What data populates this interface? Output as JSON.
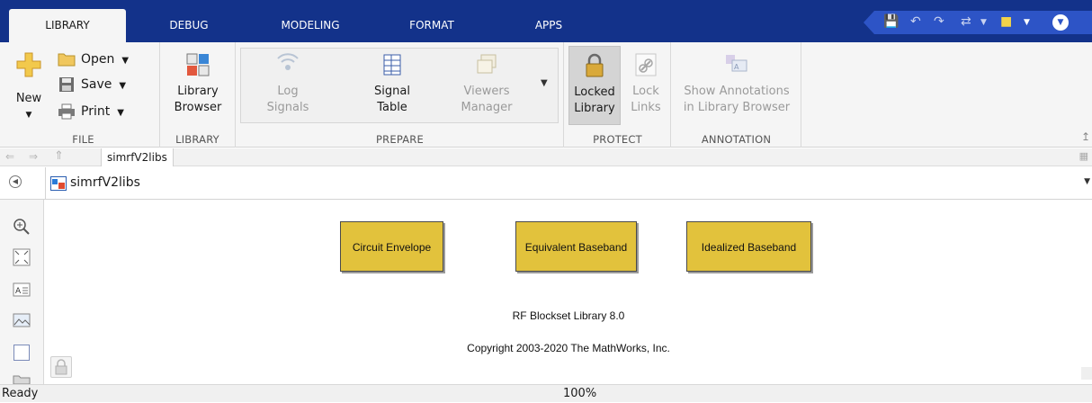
{
  "tabs": [
    {
      "label": "LIBRARY",
      "active": true
    },
    {
      "label": "DEBUG"
    },
    {
      "label": "MODELING"
    },
    {
      "label": "FORMAT"
    },
    {
      "label": "APPS"
    }
  ],
  "file": {
    "new_label": "New",
    "open_label": "Open",
    "save_label": "Save",
    "print_label": "Print",
    "group_label": "FILE"
  },
  "library": {
    "browser_line1": "Library",
    "browser_line2": "Browser",
    "group_label": "LIBRARY"
  },
  "prepare": {
    "log_line1": "Log",
    "log_line2": "Signals",
    "table_line1": "Signal",
    "table_line2": "Table",
    "viewers_line1": "Viewers",
    "viewers_line2": "Manager",
    "group_label": "PREPARE"
  },
  "protect": {
    "locked_line1": "Locked",
    "locked_line2": "Library",
    "lock_line1": "Lock",
    "lock_line2": "Links",
    "group_label": "PROTECT"
  },
  "annotation": {
    "show_line1": "Show Annotations",
    "show_line2": "in Library Browser",
    "group_label": "ANNOTATION"
  },
  "breadcrumb": {
    "label": "simrfV2libs"
  },
  "path": {
    "model_name": "simrfV2libs"
  },
  "canvas": {
    "blocks": [
      {
        "label": "Circuit Envelope"
      },
      {
        "label": "Equivalent Baseband"
      },
      {
        "label": "Idealized Baseband"
      }
    ],
    "library_title": "RF Blockset Library 8.0",
    "copyright": "Copyright 2003-2020 The MathWorks, Inc."
  },
  "status": {
    "text": "Ready",
    "zoom": "100%"
  },
  "colors": {
    "tabbar": "#13328a",
    "block_fill": "#e2c23c"
  }
}
